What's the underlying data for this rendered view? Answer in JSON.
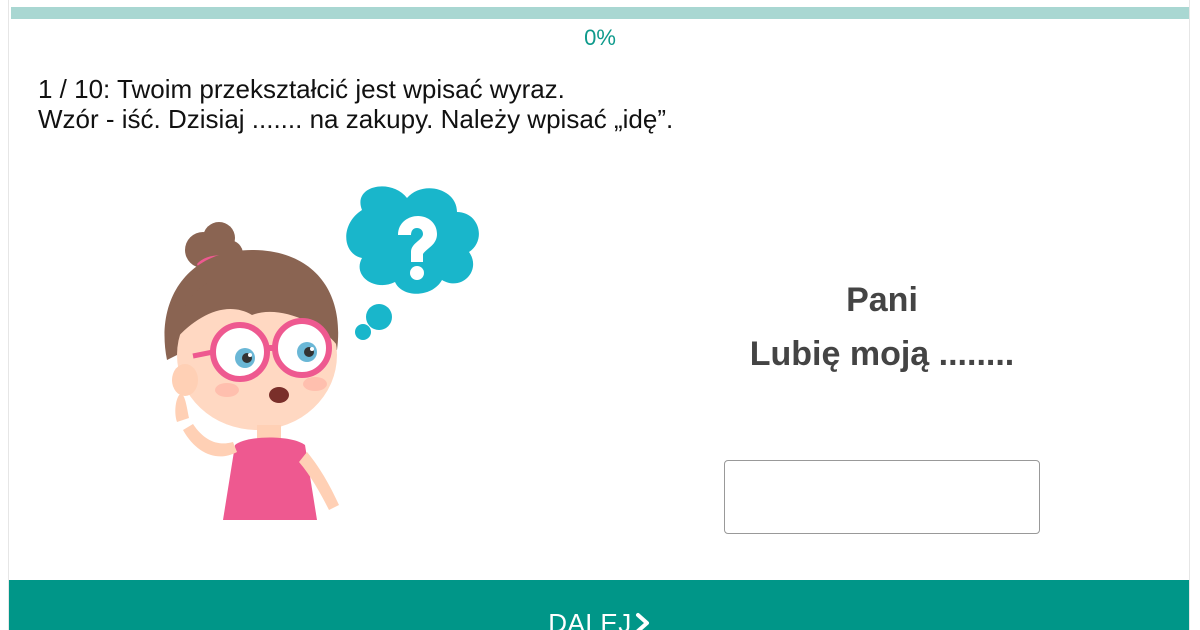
{
  "progress": {
    "value": 0.0,
    "label": "0%",
    "fill_color": "#009688",
    "track_color": "#a9d7d2"
  },
  "instructions": {
    "line1": "1 / 10: Twoim przekształcić jest wpisać wyraz.",
    "line2": "Wzór - iść. Dzisiaj ....... na zakupy. Należy wpisać „idę”."
  },
  "illustration": {
    "icon": "thinking-girl-illustration",
    "bubble_icon": "question-mark-icon"
  },
  "question": {
    "word": "Pani",
    "sentence": "Lubię moją ........"
  },
  "answer": {
    "value": "",
    "placeholder": ""
  },
  "next_button": {
    "label": "DALEJ",
    "icon": "chevron-right-icon",
    "color": "#009688"
  }
}
